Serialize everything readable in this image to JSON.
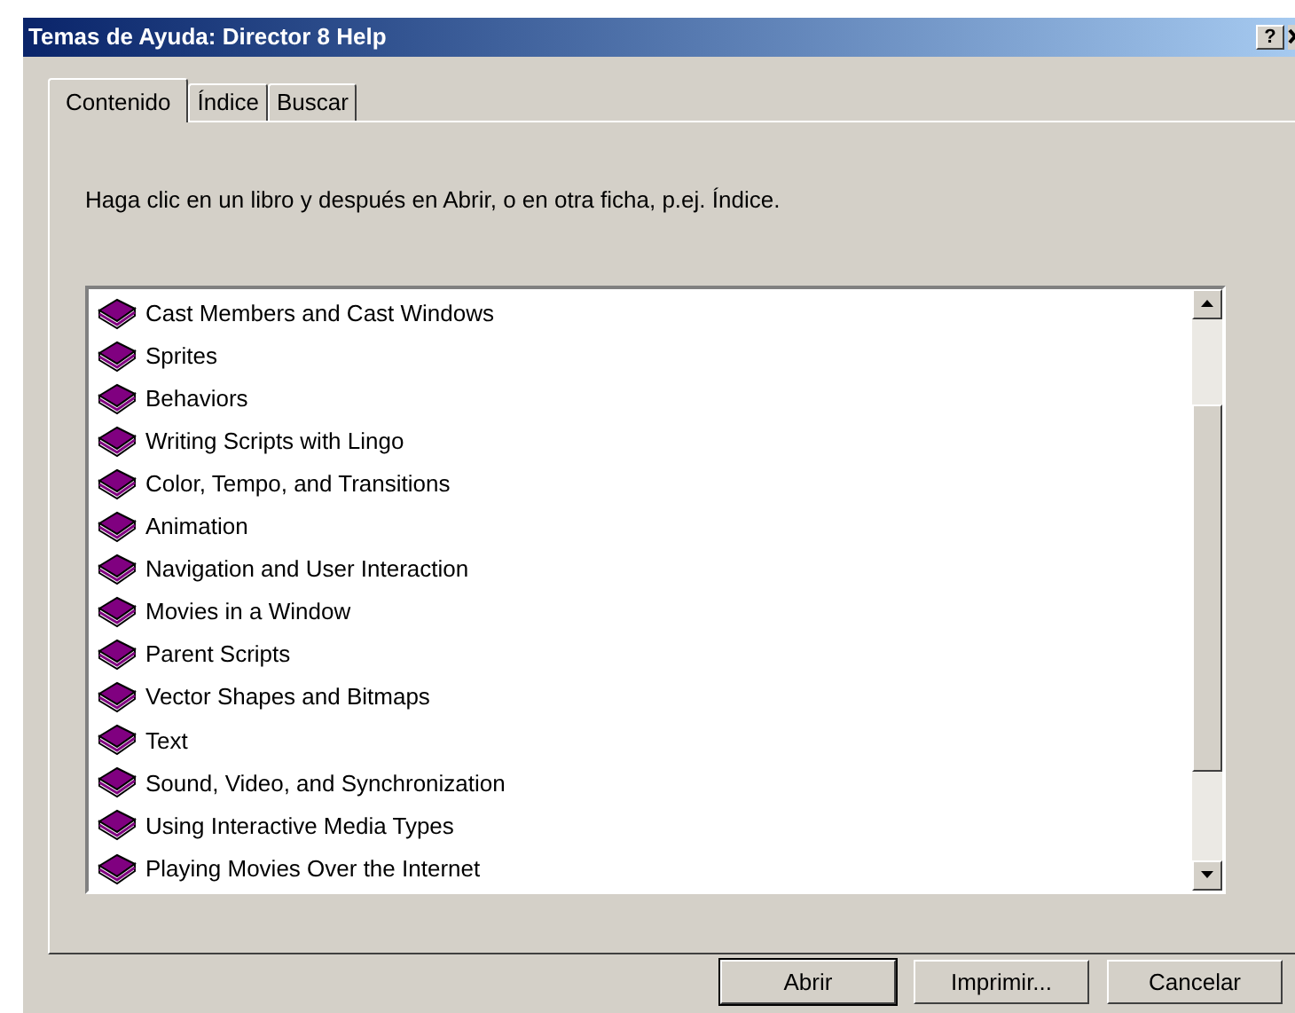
{
  "window": {
    "title": "Temas de Ayuda: Director 8 Help",
    "help_button": "?"
  },
  "tabs": [
    {
      "label": "Contenido",
      "selected": true
    },
    {
      "label": "Índice",
      "selected": false
    },
    {
      "label": "Buscar",
      "selected": false
    }
  ],
  "instruction": "Haga clic en un libro y después en Abrir, o en otra ficha, p.ej. Índice.",
  "topics": [
    "Cast Members and Cast Windows",
    "Sprites",
    "Behaviors",
    "Writing Scripts with Lingo",
    "Color, Tempo, and Transitions",
    "Animation",
    "Navigation and User Interaction",
    "Movies in a Window",
    "Parent Scripts",
    "Vector Shapes and Bitmaps",
    "Text",
    "Sound, Video, and Synchronization",
    "Using Interactive Media Types",
    "Playing Movies Over the Internet"
  ],
  "buttons": [
    {
      "label": "Abrir",
      "default": true
    },
    {
      "label": "Imprimir...",
      "default": false
    },
    {
      "label": "Cancelar",
      "default": false
    }
  ]
}
